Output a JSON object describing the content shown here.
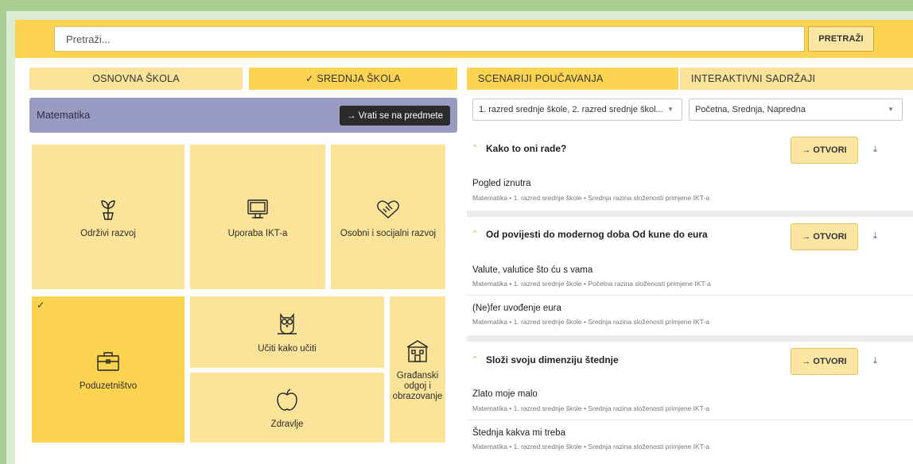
{
  "search": {
    "placeholder": "Pretraži...",
    "button_label": "PRETRAŽI"
  },
  "school_tabs": [
    {
      "label": "OSNOVNA ŠKOLA",
      "active": false
    },
    {
      "label": "SREDNJA ŠKOLA",
      "active": true,
      "check": "✓"
    }
  ],
  "subject": {
    "title": "Matematika",
    "back_button": "→  Vrati se na predmete"
  },
  "tiles": [
    {
      "label": "Održivi razvoj",
      "icon": "sprout-icon",
      "selected": false
    },
    {
      "label": "Uporaba IKT-a",
      "icon": "monitor-icon",
      "selected": false
    },
    {
      "label": "Osobni i socijalni razvoj",
      "icon": "handshake-icon",
      "selected": false
    },
    {
      "label": "Poduzetništvo",
      "icon": "briefcase-icon",
      "selected": true,
      "check": "✓"
    },
    {
      "label": "Učiti kako učiti",
      "icon": "owl-icon",
      "selected": false
    },
    {
      "label": "Građanski odgoj i obrazovanje",
      "icon": "building-icon",
      "selected": false
    },
    {
      "label": "Zdravlje",
      "icon": "apple-icon",
      "selected": false
    }
  ],
  "content_tabs": [
    {
      "label": "SCENARIJI POUČAVANJA",
      "active": true
    },
    {
      "label": "INTERAKTIVNI SADRŽAJI",
      "active": false
    }
  ],
  "filters": {
    "grade": "1. razred srednje škole, 2. razred srednje škol...",
    "level": "Početna, Srednja, Napredna",
    "caret": "▼"
  },
  "groups": [
    {
      "title": "Kako to oni rade?",
      "open_label": "→ OTVORI",
      "items": [
        {
          "title": "Pogled iznutra",
          "meta": "Matematika  •  1. razred srednje škole  •  Srednja razina složenosti primjene IKT-a"
        }
      ]
    },
    {
      "title": "Od povijesti do modernog doba Od kune do eura",
      "open_label": "→ OTVORI",
      "items": [
        {
          "title": "Valute, valutice što ću s vama",
          "meta": "Matematika  •  1. razred srednje škole  •  Početna razina složenosti primjene IKT-a"
        },
        {
          "title": "(Ne)fer uvođenje eura",
          "meta": "Matematika  •  1. razred srednje škole  •  Srednja razina složenosti primjene IKT-a"
        }
      ]
    },
    {
      "title": "Složi svoju dimenziju štednje",
      "open_label": "→ OTVORI",
      "items": [
        {
          "title": "Zlato moje malo",
          "meta": "Matematika  •  1. razred srednje škole  •  Srednja razina složenosti primjene IKT-a"
        },
        {
          "title": "Štednja kakva mi treba",
          "meta": "Matematika  •  1. razred srednje škole  •  Srednja razina složenosti primjene IKT-a"
        }
      ]
    }
  ],
  "icons": {
    "chevron": "^",
    "download": "⤓"
  },
  "colors": {
    "accent_yellow": "#fcd451",
    "light_yellow": "#fbe39a",
    "subject_purple": "#9a9bc3",
    "frame_green": "#a9cf94"
  }
}
